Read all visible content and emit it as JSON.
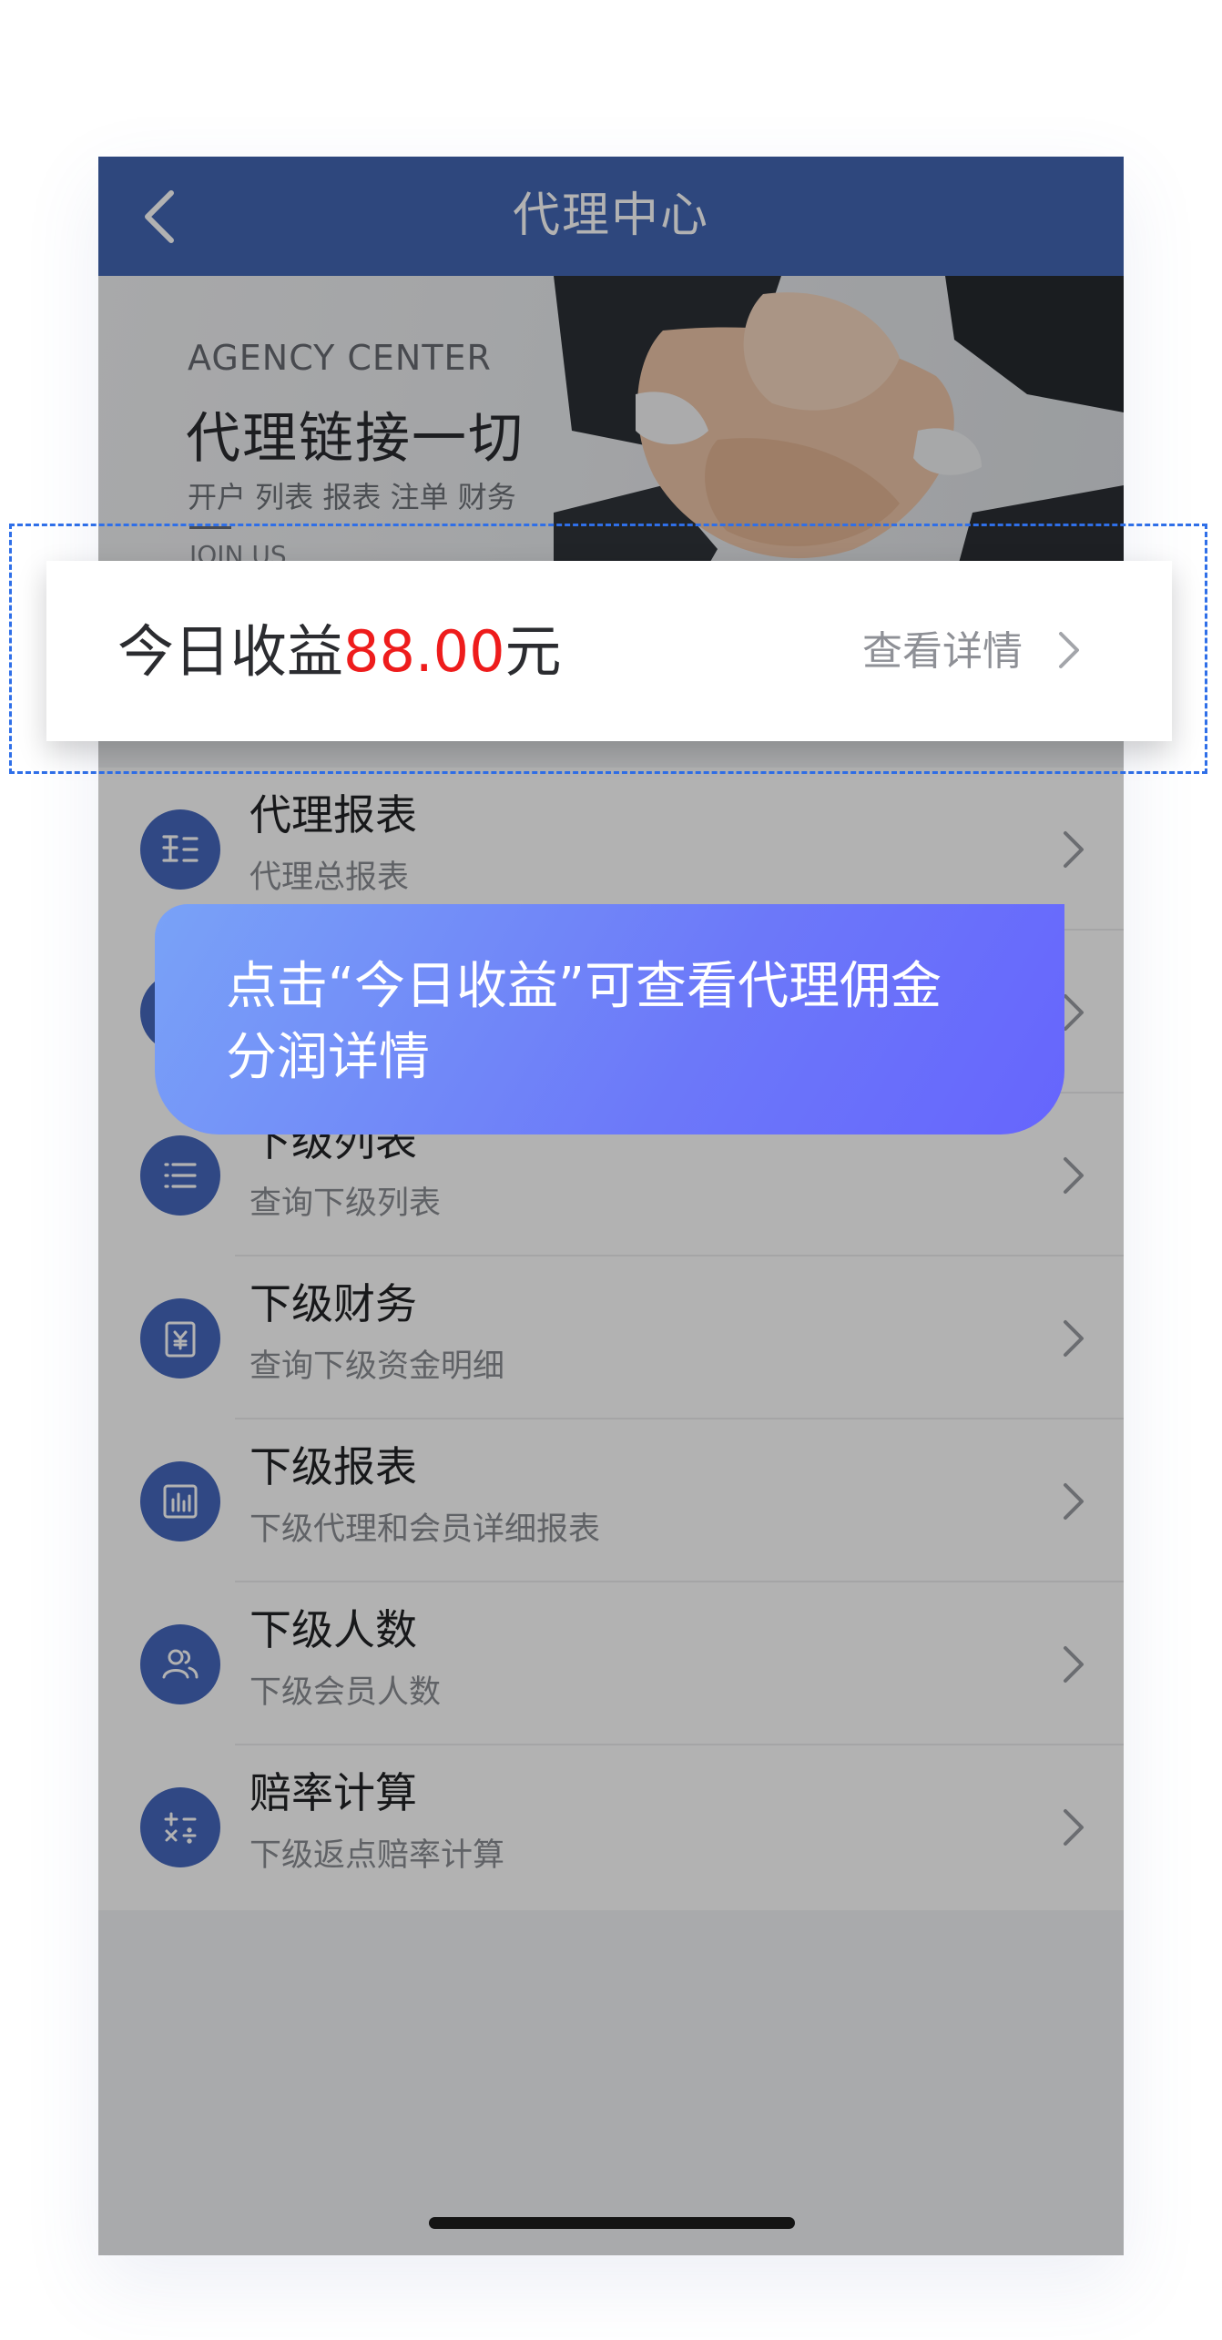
{
  "nav": {
    "title": "代理中心",
    "back_icon": "chevron-left-icon"
  },
  "banner": {
    "en": "AGENCY CENTER",
    "cn": "代理链接一切",
    "sub": "开户 列表 报表 注单 财务",
    "join": "JOIN US"
  },
  "earnings": {
    "label": "今日收益",
    "amount": "88.00",
    "unit": "元",
    "detail": "查看详情"
  },
  "tooltip": {
    "line1": "点击“今日收益”可查看代理佣金",
    "line2": "分润详情"
  },
  "menu": [
    {
      "title": "代理报表",
      "subtitle": "代理总报表",
      "icon": "report-list-icon"
    },
    {
      "title": "",
      "subtitle": "",
      "icon": "link-icon"
    },
    {
      "title": "下级列表",
      "subtitle": "查询下级列表",
      "icon": "list-icon"
    },
    {
      "title": "下级财务",
      "subtitle": "查询下级资金明细",
      "icon": "yen-document-icon"
    },
    {
      "title": "下级报表",
      "subtitle": "下级代理和会员详细报表",
      "icon": "bar-chart-icon"
    },
    {
      "title": "下级人数",
      "subtitle": "下级会员人数",
      "icon": "users-icon"
    },
    {
      "title": "赔率计算",
      "subtitle": "下级返点赔率计算",
      "icon": "calculator-icon"
    }
  ],
  "colors": {
    "nav": "#4266b4",
    "accent_red": "#ee1c1c",
    "icon_bg": "#4567bd",
    "highlight_border": "#2f6fe8"
  }
}
